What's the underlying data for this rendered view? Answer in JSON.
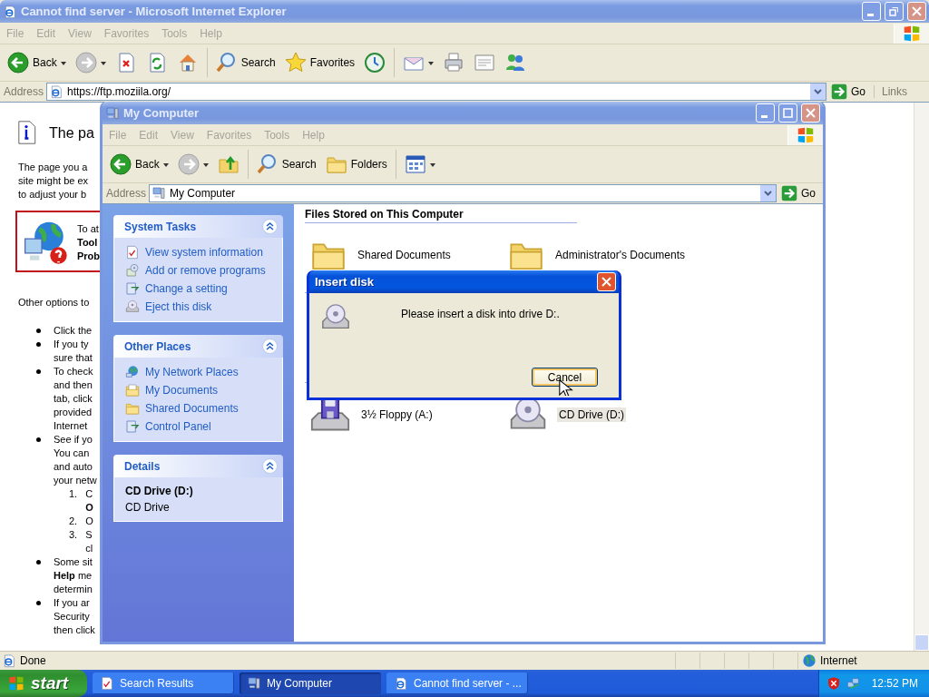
{
  "ie": {
    "title": "Cannot find server - Microsoft Internet Explorer",
    "active": false,
    "menu": [
      "File",
      "Edit",
      "View",
      "Favorites",
      "Tools",
      "Help"
    ],
    "toolbar": [
      {
        "kind": "back",
        "label": "Back",
        "dropdown": true
      },
      {
        "kind": "forward",
        "dropdown": true
      },
      {
        "kind": "stop"
      },
      {
        "kind": "refresh"
      },
      {
        "kind": "home"
      },
      {
        "kind": "search",
        "label": "Search"
      },
      {
        "kind": "favorites",
        "label": "Favorites"
      },
      {
        "kind": "history"
      },
      {
        "kind": "mail",
        "dropdown": true
      },
      {
        "kind": "print"
      },
      {
        "kind": "edit"
      },
      {
        "kind": "messenger"
      }
    ],
    "address": {
      "label": "Address",
      "value": "https://ftp.moziila.org/",
      "go": "Go",
      "links": "Links"
    },
    "page": {
      "heading": "The pa",
      "intro": [
        "The page you a",
        "site might be ex",
        "to adjust your b"
      ],
      "callout": [
        "To at",
        "**Tool**",
        "**Prob**"
      ],
      "options_intro": "Other options to",
      "bullets": [
        {
          "lines": [
            "Click the"
          ]
        },
        {
          "lines": [
            "If you ty",
            "sure that"
          ]
        },
        {
          "lines": [
            "To check",
            "and then",
            "tab, click",
            "provided",
            "Internet"
          ]
        },
        {
          "lines": [
            "See if yo",
            "You can",
            "and auto",
            "your netw"
          ],
          "steps": [
            {
              "number": "1.",
              "lines": [
                "C",
                "**O**"
              ]
            },
            {
              "number": "2.",
              "lines": [
                "O"
              ]
            },
            {
              "number": "3.",
              "lines": [
                "S",
                "cl"
              ]
            }
          ]
        },
        {
          "lines": [
            "Some sit",
            "**Help** me",
            "determin"
          ]
        },
        {
          "lines": [
            "If you ar",
            "Security",
            "then click"
          ]
        }
      ]
    },
    "status": {
      "text": "Done",
      "zone": "Internet"
    }
  },
  "explorer": {
    "title": "My Computer",
    "active": false,
    "menu": [
      "File",
      "Edit",
      "View",
      "Favorites",
      "Tools",
      "Help"
    ],
    "toolbar": [
      {
        "kind": "back",
        "label": "Back",
        "dropdown": true
      },
      {
        "kind": "forward",
        "dropdown": true
      },
      {
        "kind": "up"
      },
      {
        "kind": "search",
        "label": "Search"
      },
      {
        "kind": "folders",
        "label": "Folders"
      },
      {
        "kind": "views",
        "dropdown": true
      }
    ],
    "address": {
      "label": "Address",
      "value": "My Computer",
      "go": "Go"
    },
    "panels": [
      {
        "title": "System Tasks",
        "expanded": true,
        "items": [
          {
            "kind": "info",
            "label": "View system information"
          },
          {
            "kind": "programs",
            "label": "Add or remove programs"
          },
          {
            "kind": "setting",
            "label": "Change a setting"
          },
          {
            "kind": "eject",
            "label": "Eject this disk"
          }
        ]
      },
      {
        "title": "Other Places",
        "expanded": true,
        "items": [
          {
            "kind": "network",
            "label": "My Network Places"
          },
          {
            "kind": "documents",
            "label": "My Documents"
          },
          {
            "kind": "folder",
            "label": "Shared Documents"
          },
          {
            "kind": "setting",
            "label": "Control Panel"
          }
        ]
      },
      {
        "title": "Details",
        "expanded": true,
        "details": {
          "name": "CD Drive (D:)",
          "description": "CD Drive"
        }
      }
    ],
    "section_title": "Files Stored on This Computer",
    "files": [
      {
        "kind": "folder",
        "label": "Shared Documents",
        "selected": false
      },
      {
        "kind": "folder",
        "label": "Administrator's Documents",
        "selected": false
      }
    ],
    "drives": [
      {
        "kind": "floppy",
        "label": "3½ Floppy (A:)",
        "selected": false
      },
      {
        "kind": "cd",
        "label": "CD Drive (D:)",
        "selected": true
      }
    ]
  },
  "dialog": {
    "title": "Insert disk",
    "active": true,
    "message": "Please insert a disk into drive D:.",
    "button": "Cancel"
  },
  "taskbar": {
    "start": "start",
    "tasks": [
      {
        "kind": "search",
        "label": "Search Results",
        "selected": false
      },
      {
        "kind": "computer",
        "label": "My Computer",
        "selected": true
      },
      {
        "kind": "ie",
        "label": "Cannot find server - ...",
        "selected": false
      }
    ],
    "clock": "12:52 PM"
  }
}
